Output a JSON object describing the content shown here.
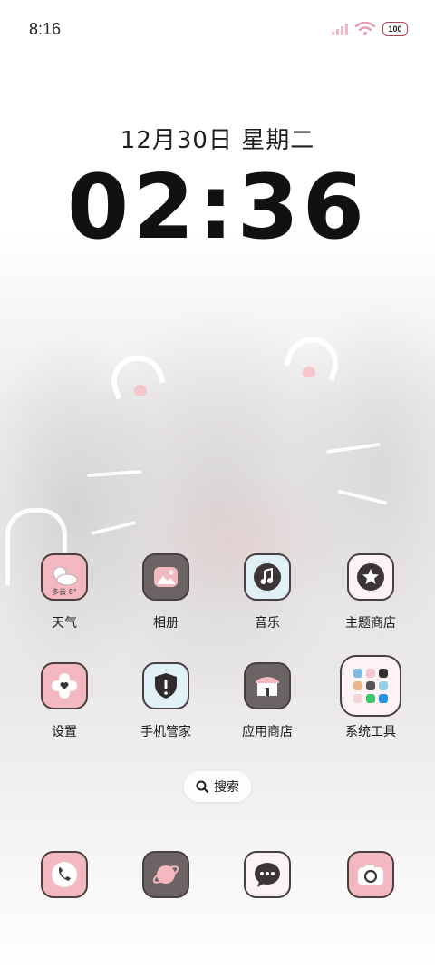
{
  "status_bar": {
    "time": "8:16",
    "battery": "100"
  },
  "lockscreen_widget": {
    "date": "12月30日 星期二",
    "clock": "02:36"
  },
  "apps": [
    {
      "label": "天气",
      "icon": "weather-icon",
      "weather_text": "多云 8°"
    },
    {
      "label": "相册",
      "icon": "photo-gallery-icon"
    },
    {
      "label": "音乐",
      "icon": "music-note-icon"
    },
    {
      "label": "主题商店",
      "icon": "theme-store-star-icon"
    },
    {
      "label": "设置",
      "icon": "settings-heart-icon"
    },
    {
      "label": "手机管家",
      "icon": "phone-manager-shield-icon"
    },
    {
      "label": "应用商店",
      "icon": "app-store-shop-icon"
    },
    {
      "label": "系统工具",
      "icon": "system-tools-folder-icon"
    }
  ],
  "search": {
    "label": "搜索"
  },
  "dock": [
    {
      "icon": "phone-icon"
    },
    {
      "icon": "browser-planet-icon"
    },
    {
      "icon": "messages-icon"
    },
    {
      "icon": "camera-icon"
    }
  ],
  "colors": {
    "icon_pink": "#f4b8c1",
    "icon_dark": "#6c6364",
    "icon_outline": "#4a3f40",
    "status_accent": "#e79aa8"
  }
}
